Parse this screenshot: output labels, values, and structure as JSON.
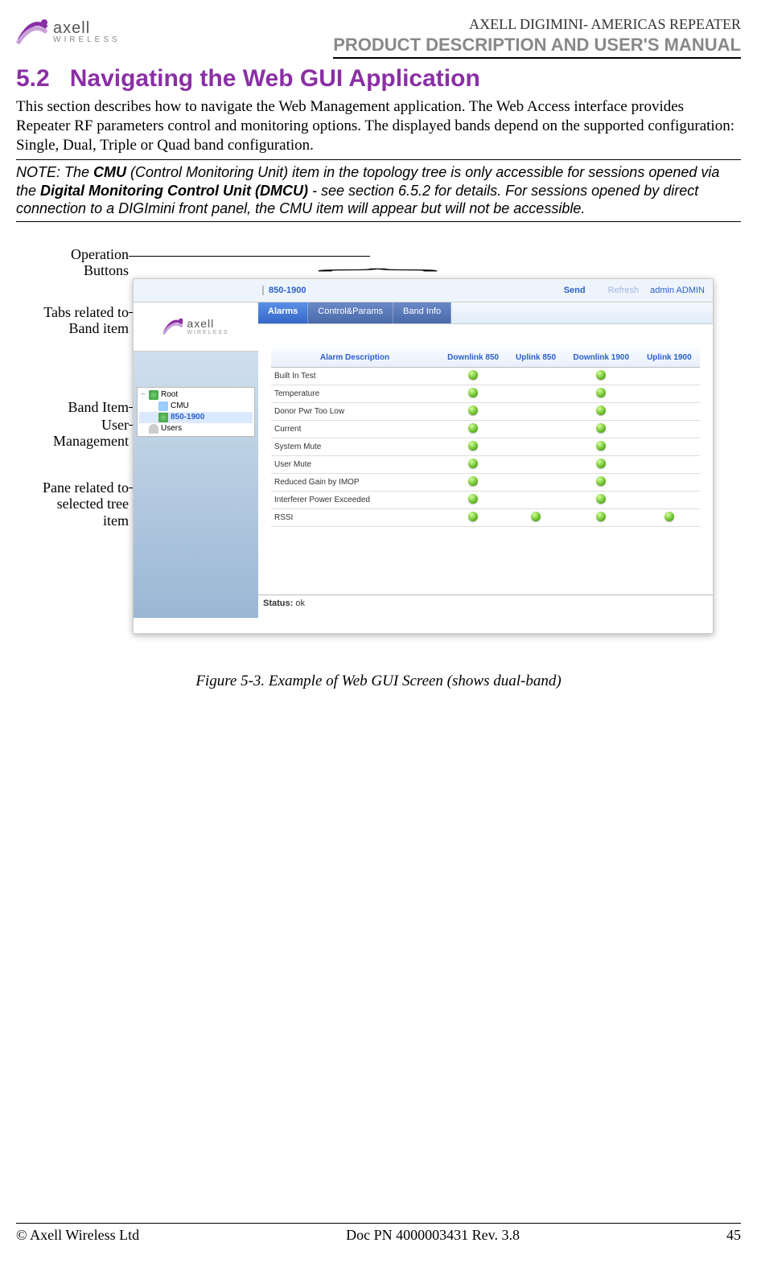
{
  "header": {
    "logo_name": "axell",
    "logo_sub": "WIRELESS",
    "right_line_a": "AXELL DIGIMINI- AMERICAS REPEATER",
    "right_line_b": "PRODUCT DESCRIPTION AND USER'S MANUAL"
  },
  "section": {
    "number": "5.2",
    "title": "Navigating the Web GUI Application",
    "para": "This section describes how to navigate the Web Management application. The Web Access interface provides Repeater RF parameters control and monitoring options. The displayed bands depend on the supported configuration: Single, Dual, Triple or Quad band configuration.",
    "note_prefix": "NOTE: The ",
    "note_bold1": "CMU",
    "note_mid1": " (Control Monitoring Unit) item in the topology tree is only accessible for sessions opened via the ",
    "note_bold2": "Digital Monitoring Control Unit (DMCU)",
    "note_mid2": " - see section 6.5.2 for details. For sessions opened by direct connection to a DIGImini front panel, the CMU item will appear but will not be accessible."
  },
  "callouts": {
    "operation_buttons_l1": "Operation",
    "operation_buttons_l2": "Buttons",
    "tabs_l1": "Tabs related to",
    "tabs_l2": "Band item",
    "band_item": "Band Item",
    "user_l1": "User",
    "user_l2": "Management",
    "pane_l1": "Pane related to",
    "pane_l2": "selected tree",
    "pane_l3": "item"
  },
  "screenshot": {
    "breadcrumb": "850-1900",
    "send": "Send",
    "refresh": "Refresh",
    "user": "admin ADMIN",
    "logo_name": "axell",
    "logo_sub": "WIRELESS",
    "tree": {
      "root": "Root",
      "cmu": "CMU",
      "band": "850-1900",
      "users": "Users"
    },
    "tabs": {
      "alarms": "Alarms",
      "control": "Control&Params",
      "bandinfo": "Band Info"
    },
    "table": {
      "h_desc": "Alarm Description",
      "h_dl850": "Downlink 850",
      "h_ul850": "Uplink 850",
      "h_dl1900": "Downlink 1900",
      "h_ul1900": "Uplink 1900",
      "rows": [
        {
          "desc": "Built In Test",
          "d850": true,
          "u850": false,
          "d1900": true,
          "u1900": false
        },
        {
          "desc": "Temperature",
          "d850": true,
          "u850": false,
          "d1900": true,
          "u1900": false
        },
        {
          "desc": "Donor Pwr Too Low",
          "d850": true,
          "u850": false,
          "d1900": true,
          "u1900": false
        },
        {
          "desc": "Current",
          "d850": true,
          "u850": false,
          "d1900": true,
          "u1900": false
        },
        {
          "desc": "System Mute",
          "d850": true,
          "u850": false,
          "d1900": true,
          "u1900": false
        },
        {
          "desc": "User Mute",
          "d850": true,
          "u850": false,
          "d1900": true,
          "u1900": false
        },
        {
          "desc": "Reduced Gain by IMOP",
          "d850": true,
          "u850": false,
          "d1900": true,
          "u1900": false
        },
        {
          "desc": "Interferer Power Exceeded",
          "d850": true,
          "u850": false,
          "d1900": true,
          "u1900": false
        },
        {
          "desc": "RSSI",
          "d850": true,
          "u850": true,
          "d1900": true,
          "u1900": true
        }
      ]
    },
    "status_label": "Status:",
    "status_value": "ok"
  },
  "figure_caption": "Figure 5-3. Example of Web GUI Screen (shows dual-band)",
  "footer": {
    "left": "© Axell Wireless Ltd",
    "center": "Doc PN 4000003431 Rev. 3.8",
    "right": "45"
  }
}
